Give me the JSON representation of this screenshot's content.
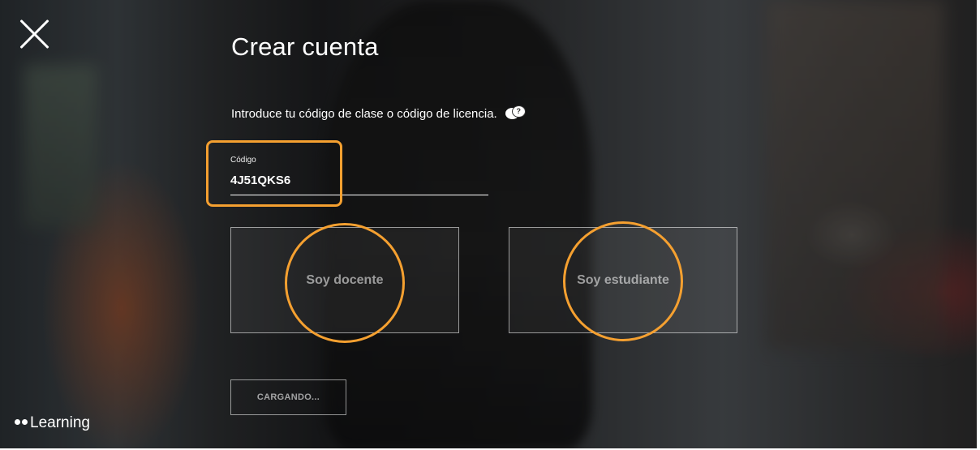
{
  "page": {
    "title": "Crear cuenta",
    "instruction": "Introduce tu código de clase o código de licencia."
  },
  "code_field": {
    "label": "Código",
    "value": "4J51QKS6"
  },
  "roles": {
    "teacher_label": "Soy docente",
    "student_label": "Soy estudiante"
  },
  "status_button": {
    "label": "CARGANDO..."
  },
  "brand": {
    "name": "Learning"
  },
  "icons": {
    "close": "close-icon",
    "help": "help-chat-icon",
    "brand": "brand-dots-icon"
  },
  "colors": {
    "highlight": "#f5a030",
    "text": "#ffffff"
  }
}
